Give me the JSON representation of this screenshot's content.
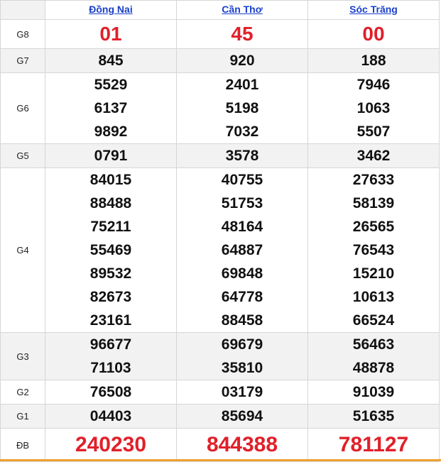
{
  "provinces": [
    "Đồng Nai",
    "Cần Thơ",
    "Sóc Trăng"
  ],
  "rows": [
    {
      "label": "G8",
      "shade": false,
      "style": "red",
      "values": [
        [
          "01"
        ],
        [
          "45"
        ],
        [
          "00"
        ]
      ]
    },
    {
      "label": "G7",
      "shade": true,
      "style": "normal",
      "values": [
        [
          "845"
        ],
        [
          "920"
        ],
        [
          "188"
        ]
      ]
    },
    {
      "label": "G6",
      "shade": false,
      "style": "normal",
      "values": [
        [
          "5529",
          "6137",
          "9892"
        ],
        [
          "2401",
          "5198",
          "7032"
        ],
        [
          "7946",
          "1063",
          "5507"
        ]
      ]
    },
    {
      "label": "G5",
      "shade": true,
      "style": "normal",
      "values": [
        [
          "0791"
        ],
        [
          "3578"
        ],
        [
          "3462"
        ]
      ]
    },
    {
      "label": "G4",
      "shade": false,
      "style": "normal",
      "values": [
        [
          "84015",
          "88488",
          "75211",
          "55469",
          "89532",
          "82673",
          "23161"
        ],
        [
          "40755",
          "51753",
          "48164",
          "64887",
          "69848",
          "64778",
          "88458"
        ],
        [
          "27633",
          "58139",
          "26565",
          "76543",
          "15210",
          "10613",
          "66524"
        ]
      ]
    },
    {
      "label": "G3",
      "shade": true,
      "style": "normal",
      "values": [
        [
          "96677",
          "71103"
        ],
        [
          "69679",
          "35810"
        ],
        [
          "56463",
          "48878"
        ]
      ]
    },
    {
      "label": "G2",
      "shade": false,
      "style": "normal",
      "values": [
        [
          "76508"
        ],
        [
          "03179"
        ],
        [
          "91039"
        ]
      ]
    },
    {
      "label": "G1",
      "shade": true,
      "style": "normal",
      "values": [
        [
          "04403"
        ],
        [
          "85694"
        ],
        [
          "51635"
        ]
      ]
    },
    {
      "label": "ĐB",
      "shade": false,
      "style": "db",
      "values": [
        [
          "240230"
        ],
        [
          "844388"
        ],
        [
          "781127"
        ]
      ]
    }
  ],
  "colors": {
    "prize_red": "#e0202a",
    "link_blue": "#1a3fcc",
    "shade": "#f2f2f2",
    "accent": "#f0a030"
  }
}
